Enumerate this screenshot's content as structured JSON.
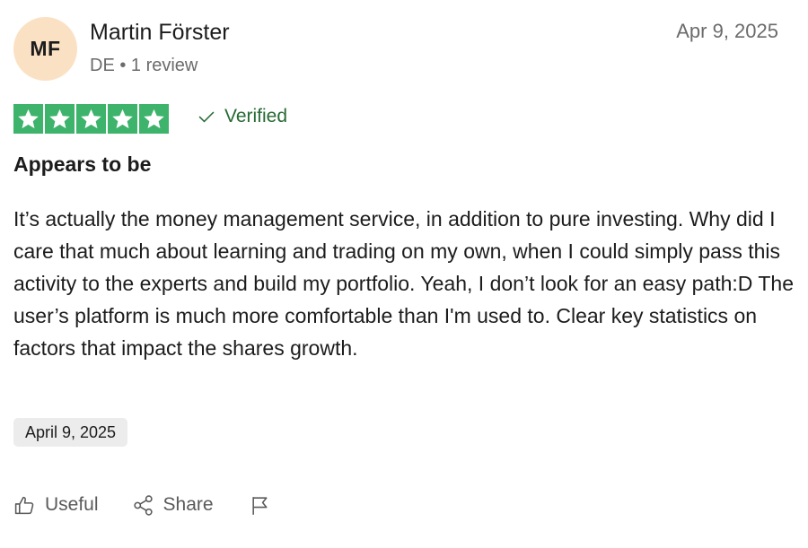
{
  "reviewer": {
    "initials": "MF",
    "name": "Martin Förster",
    "meta": "DE • 1 review"
  },
  "review": {
    "date_posted": "Apr 9, 2025",
    "rating": 5,
    "rating_max": 5,
    "star_color": "#3db36b",
    "verified_label": "Verified",
    "title": "Appears to be",
    "body": "It’s actually the money management service, in addition to pure investing. Why did I care that much about learning and trading on my own, when I could simply pass this activity to the experts and build my portfolio. Yeah, I don’t look for an easy path:D The user’s platform is much more comfortable than I'm used to. Clear key statistics on factors that impact the shares growth.",
    "experience_date": "April 9, 2025"
  },
  "actions": {
    "useful_label": "Useful",
    "share_label": "Share",
    "icons": [
      "thumbs-up-icon",
      "share-icon",
      "flag-icon"
    ]
  }
}
